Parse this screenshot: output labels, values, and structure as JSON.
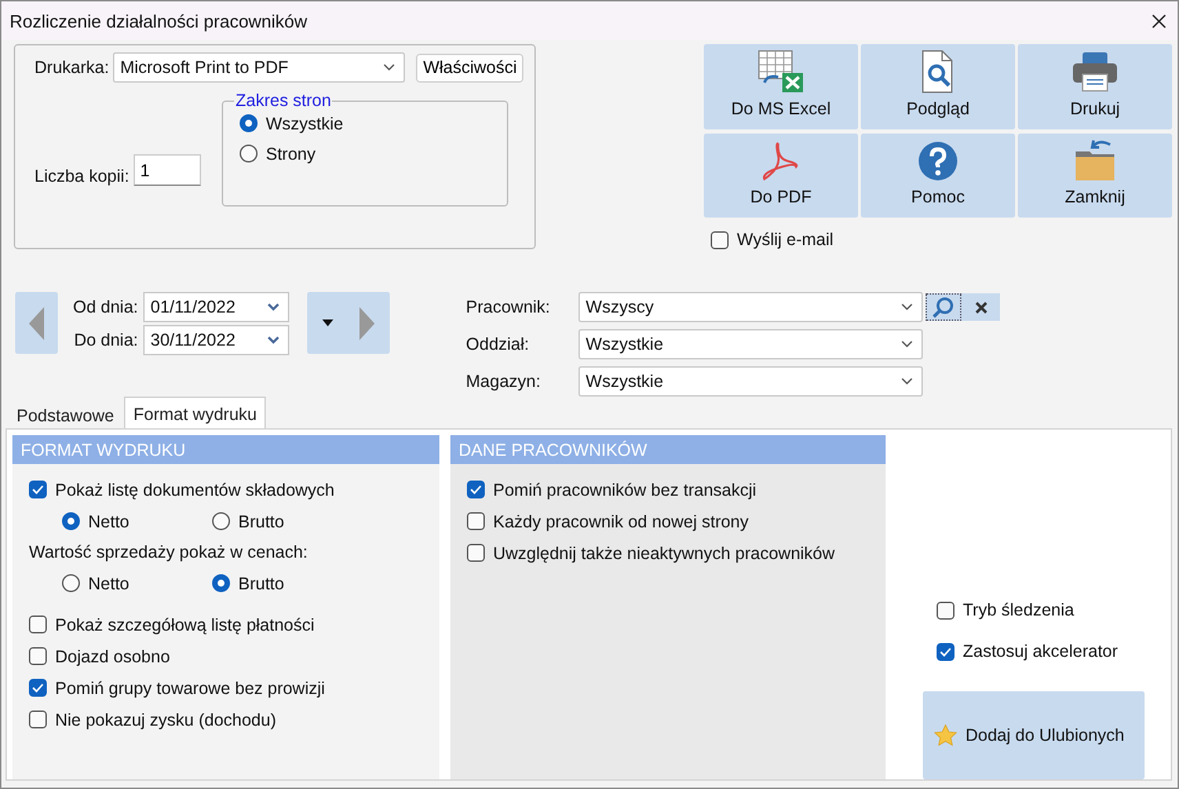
{
  "window": {
    "title": "Rozliczenie działalności pracowników"
  },
  "print": {
    "printer_label": "Drukarka:",
    "printer": "Microsoft Print to PDF",
    "properties_button": "Właściwości",
    "copies_label": "Liczba kopii:",
    "copies": "1",
    "page_range": {
      "title": "Zakres stron",
      "options": [
        {
          "label": "Wszystkie",
          "selected": true
        },
        {
          "label": "Strony",
          "selected": false
        }
      ]
    }
  },
  "actions": [
    {
      "label": "Do MS Excel",
      "kind": "excel"
    },
    {
      "label": "Podgląd",
      "kind": "preview"
    },
    {
      "label": "Drukuj",
      "kind": "print"
    },
    {
      "label": "Do PDF",
      "kind": "pdf"
    },
    {
      "label": "Pomoc",
      "kind": "help"
    },
    {
      "label": "Zamknij",
      "kind": "close"
    }
  ],
  "send_email": {
    "label": "Wyślij e-mail",
    "checked": false
  },
  "dates": [
    {
      "label": "Od dnia:",
      "value": "01/11/2022"
    },
    {
      "label": "Do dnia:",
      "value": "30/11/2022"
    }
  ],
  "filters": [
    {
      "label": "Pracownik:",
      "value": "Wszyscy",
      "kind": "searchable"
    },
    {
      "label": "Oddział:",
      "value": "Wszystkie",
      "kind": "plain"
    },
    {
      "label": "Magazyn:",
      "value": "Wszystkie",
      "kind": "plain"
    }
  ],
  "tabs": [
    {
      "label": "Podstawowe",
      "selected": false
    },
    {
      "label": "Format wydruku",
      "selected": true
    }
  ],
  "format_section": {
    "title": "FORMAT WYDRUKU",
    "items": [
      {
        "kind": "checkbox",
        "label": "Pokaż listę dokumentów składowych",
        "checked": true
      },
      {
        "kind": "radios",
        "options": [
          {
            "label": "Netto",
            "selected": true
          },
          {
            "label": "Brutto",
            "selected": false
          }
        ]
      },
      {
        "kind": "text",
        "label": "Wartość sprzedaży pokaż w cenach:"
      },
      {
        "kind": "radios",
        "options": [
          {
            "label": "Netto",
            "selected": false
          },
          {
            "label": "Brutto",
            "selected": true
          }
        ]
      },
      {
        "kind": "checkbox",
        "label": "Pokaż szczegółową listę płatności",
        "checked": false
      },
      {
        "kind": "checkbox",
        "label": "Dojazd osobno",
        "checked": false
      },
      {
        "kind": "checkbox",
        "label": "Pomiń grupy towarowe bez prowizji",
        "checked": true
      },
      {
        "kind": "checkbox",
        "label": "Nie pokazuj zysku (dochodu)",
        "checked": false
      }
    ]
  },
  "employee_section": {
    "title": "DANE PRACOWNIKÓW",
    "items": [
      {
        "label": "Pomiń pracowników bez transakcji",
        "checked": true
      },
      {
        "label": "Każdy pracownik od nowej strony",
        "checked": false
      },
      {
        "label": "Uwzględnij także nieaktywnych pracowników",
        "checked": false
      }
    ]
  },
  "options": [
    {
      "label": "Tryb śledzenia",
      "checked": false
    },
    {
      "label": "Zastosuj akcelerator",
      "checked": true
    }
  ],
  "favorite_button": {
    "label": "Dodaj do Ulubionych"
  }
}
